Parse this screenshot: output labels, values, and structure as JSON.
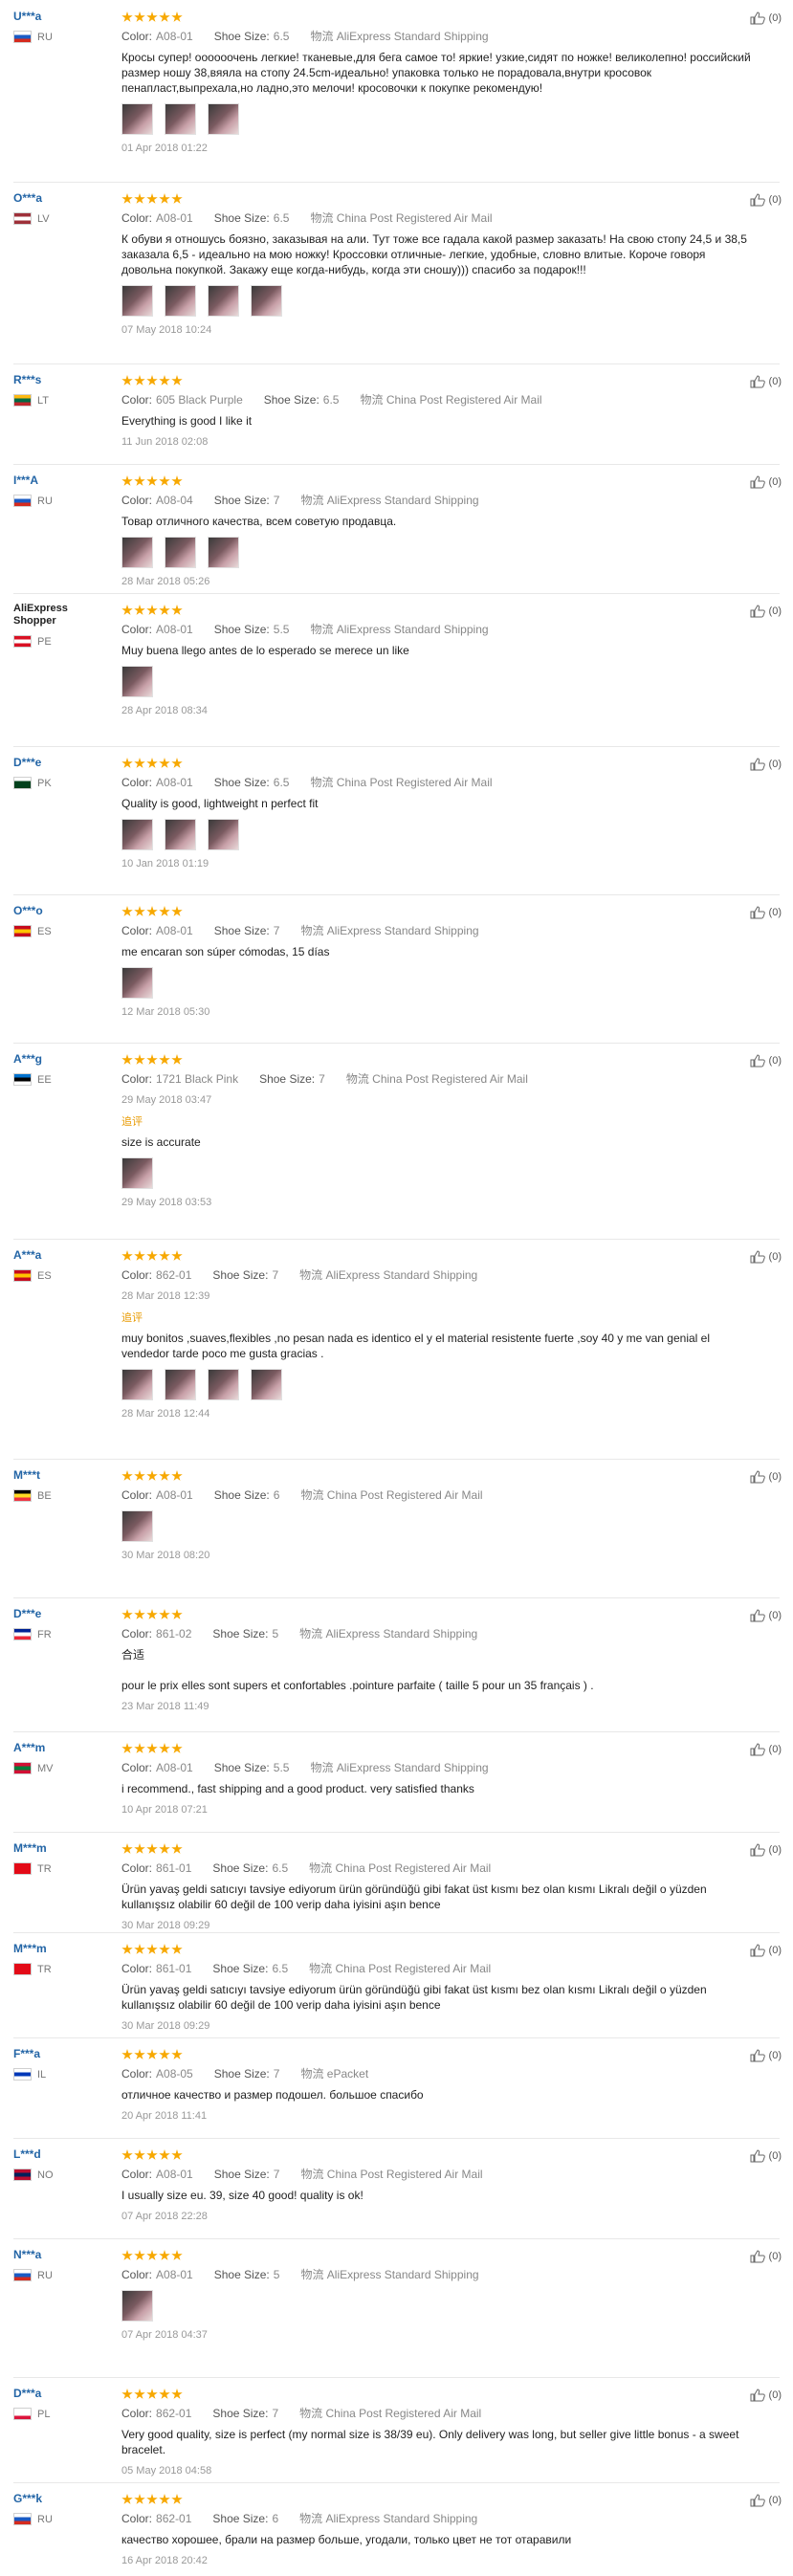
{
  "labels": {
    "color": "Color:",
    "shoe_size": "Shoe Size:",
    "added": "追评"
  },
  "reviews": [
    {
      "user": "U***a",
      "country": "RU",
      "flag": [
        "#ffffff",
        "#1a5bc4",
        "#d52b1e"
      ],
      "color": "A08-01",
      "size": "6.5",
      "ship": "物流 AliExpress Standard Shipping",
      "text": "Кросы супер! оооооочень легкие! тканевые,для бега самое то! яркие! узкие,сидят по ножке! великолепно! российский размер ношу 38,вяяла на стопу 24.5cm-идеально! упаковка только не порадовала,внутри кросовок пенапласт,выпрехала,но ладно,это мелочи! кросовочки к покупке рекомендую!",
      "photos": 3,
      "date": "01 Apr 2018 01:22",
      "helpful": "(0)"
    },
    {
      "user": "O***a",
      "country": "LV",
      "flag": [
        "#9e3039",
        "#ffffff",
        "#9e3039"
      ],
      "color": "A08-01",
      "size": "6.5",
      "ship": "物流 China Post Registered Air Mail",
      "text": "К обуви я отношусь боязно, заказывая на али. Тут тоже все гадала какой размер заказать! На свою стопу 24,5 и 38,5 заказала 6,5 - идеально на мою ножку! Кроссовки отличные- легкие, удобные, словно влитые. Короче говоря довольна покупкой. Закажу еще когда-нибудь, когда эти сношу))) спасибо за подарок!!!",
      "photos": 4,
      "date": "07 May 2018 10:24",
      "helpful": "(0)"
    },
    {
      "user": "R***s",
      "country": "LT",
      "flag": [
        "#fdb913",
        "#006a44",
        "#c1272d"
      ],
      "color": "605 Black Purple",
      "size": "6.5",
      "ship": "物流 China Post Registered Air Mail",
      "text": "Everything is good I like it",
      "photos": 0,
      "date": "11 Jun 2018 02:08",
      "helpful": "(0)"
    },
    {
      "user": "I***A",
      "country": "RU",
      "flag": [
        "#ffffff",
        "#1a5bc4",
        "#d52b1e"
      ],
      "color": "A08-04",
      "size": "7",
      "ship": "物流 AliExpress Standard Shipping",
      "text": "Товар отличного качества, всем советую продавца.",
      "photos": 3,
      "date": "28 Mar 2018 05:26",
      "helpful": "(0)"
    },
    {
      "user": "AliExpress Shopper",
      "shopper": true,
      "country": "PE",
      "flag": [
        "#d91023",
        "#ffffff",
        "#d91023"
      ],
      "color": "A08-01",
      "size": "5.5",
      "ship": "物流 AliExpress Standard Shipping",
      "text": "Muy buena llego antes de lo esperado se merece un like",
      "photos": 1,
      "date": "28 Apr 2018 08:34",
      "helpful": "(0)"
    },
    {
      "user": "D***e",
      "country": "PK",
      "flag": [
        "#ffffff",
        "#01411c",
        "#01411c"
      ],
      "color": "A08-01",
      "size": "6.5",
      "ship": "物流 China Post Registered Air Mail",
      "text": "Quality is good, lightweight n perfect fit",
      "photos": 3,
      "date": "10 Jan 2018 01:19",
      "helpful": "(0)"
    },
    {
      "user": "O***o",
      "country": "ES",
      "flag": [
        "#c60b1e",
        "#ffc400",
        "#c60b1e"
      ],
      "color": "A08-01",
      "size": "7",
      "ship": "物流 AliExpress Standard Shipping",
      "text": "me encaran son súper cómodas, 15 días",
      "photos": 1,
      "date": "12 Mar 2018 05:30",
      "helpful": "(0)"
    },
    {
      "user": "A***g",
      "country": "EE",
      "flag": [
        "#0072ce",
        "#000000",
        "#ffffff"
      ],
      "color": "1721 Black Pink",
      "size": "7",
      "ship": "物流 China Post Registered Air Mail",
      "text": "",
      "photos": 0,
      "date": "29 May 2018 03:47",
      "added_text": "size is accurate",
      "added_photos": 1,
      "added_date": "29 May 2018 03:53",
      "helpful": "(0)"
    },
    {
      "user": "A***a",
      "country": "ES",
      "flag": [
        "#c60b1e",
        "#ffc400",
        "#c60b1e"
      ],
      "color": "862-01",
      "size": "7",
      "ship": "物流 AliExpress Standard Shipping",
      "text": "",
      "photos": 0,
      "date": "28 Mar 2018 12:39",
      "added_text": "muy bonitos ,suaves,flexibles ,no pesan nada es identico el y el material resistente fuerte ,soy 40 y me van genial el vendedor tarde poco me gusta gracias .",
      "added_photos": 4,
      "added_date": "28 Mar 2018 12:44",
      "helpful": "(0)"
    },
    {
      "user": "M***t",
      "country": "BE",
      "flag": [
        "#000000",
        "#fdda24",
        "#ef3340"
      ],
      "color": "A08-01",
      "size": "6",
      "ship": "物流 China Post Registered Air Mail",
      "text": "",
      "photos": 1,
      "date": "30 Mar 2018 08:20",
      "helpful": "(0)"
    },
    {
      "user": "D***e",
      "country": "FR",
      "flag": [
        "#002395",
        "#ffffff",
        "#ed2939"
      ],
      "color": "861-02",
      "size": "5",
      "ship": "物流 AliExpress Standard Shipping",
      "text": "合适\n\npour le prix elles sont supers et confortables .pointure parfaite ( taille 5 pour un 35 français ) .",
      "photos": 0,
      "date": "23 Mar 2018 11:49",
      "helpful": "(0)"
    },
    {
      "user": "A***m",
      "country": "MV",
      "flag": [
        "#d21034",
        "#007e3a",
        "#d21034"
      ],
      "color": "A08-01",
      "size": "5.5",
      "ship": "物流 AliExpress Standard Shipping",
      "text": "i recommend., fast shipping and a good product. very satisfied thanks",
      "photos": 0,
      "date": "10 Apr 2018 07:21",
      "helpful": "(0)"
    },
    {
      "user": "M***m",
      "country": "TR",
      "flag": [
        "#e30a17",
        "#e30a17",
        "#e30a17"
      ],
      "color": "861-01",
      "size": "6.5",
      "ship": "物流 China Post Registered Air Mail",
      "text": "Ürün yavaş geldi satıcıyı tavsiye ediyorum ürün göründüğü gibi fakat üst kısmı bez olan kısmı Likralı değil o yüzden kullanışsız olabilir 60 değil de 100 verip daha iyisini aşın bence",
      "photos": 0,
      "date": "30 Mar 2018 09:29",
      "helpful": "(0)"
    },
    {
      "user": "M***m",
      "country": "TR",
      "flag": [
        "#e30a17",
        "#e30a17",
        "#e30a17"
      ],
      "color": "861-01",
      "size": "6.5",
      "ship": "物流 China Post Registered Air Mail",
      "text": "Ürün yavaş geldi satıcıyı tavsiye ediyorum ürün göründüğü gibi fakat üst kısmı bez olan kısmı Likralı değil o yüzden kullanışsız olabilir 60 değil de 100 verip daha iyisini aşın bence",
      "photos": 0,
      "date": "30 Mar 2018 09:29",
      "helpful": "(0)"
    },
    {
      "user": "F***a",
      "country": "IL",
      "flag": [
        "#ffffff",
        "#0038b8",
        "#ffffff"
      ],
      "color": "A08-05",
      "size": "7",
      "ship": "物流 ePacket",
      "text": "отличное качество и размер подошел. большое спасибо",
      "photos": 0,
      "date": "20 Apr 2018 11:41",
      "helpful": "(0)"
    },
    {
      "user": "L***d",
      "country": "NO",
      "flag": [
        "#ba0c2f",
        "#00205b",
        "#ba0c2f"
      ],
      "color": "A08-01",
      "size": "7",
      "ship": "物流 China Post Registered Air Mail",
      "text": "I usually size eu. 39, size 40 good! quality is ok!",
      "photos": 0,
      "date": "07 Apr 2018 22:28",
      "helpful": "(0)"
    },
    {
      "user": "N***a",
      "country": "RU",
      "flag": [
        "#ffffff",
        "#1a5bc4",
        "#d52b1e"
      ],
      "color": "A08-01",
      "size": "5",
      "ship": "物流 AliExpress Standard Shipping",
      "text": "",
      "photos": 1,
      "date": "07 Apr 2018 04:37",
      "helpful": "(0)"
    },
    {
      "user": "D***a",
      "country": "PL",
      "flag": [
        "#ffffff",
        "#ffffff",
        "#dc143c"
      ],
      "color": "862-01",
      "size": "7",
      "ship": "物流 China Post Registered Air Mail",
      "text": "Very good quality, size is perfect (my normal size is 38/39 eu). Only delivery was long, but seller give little bonus - a sweet bracelet.",
      "photos": 0,
      "date": "05 May 2018 04:58",
      "helpful": "(0)"
    },
    {
      "user": "G***k",
      "country": "RU",
      "flag": [
        "#ffffff",
        "#1a5bc4",
        "#d52b1e"
      ],
      "color": "862-01",
      "size": "6",
      "ship": "物流 AliExpress Standard Shipping",
      "text": "качество хорошее, брали на размер больше, угодали, только цвет не тот отаравили",
      "photos": 0,
      "date": "16 Apr 2018 20:42",
      "helpful": "(0)"
    }
  ]
}
